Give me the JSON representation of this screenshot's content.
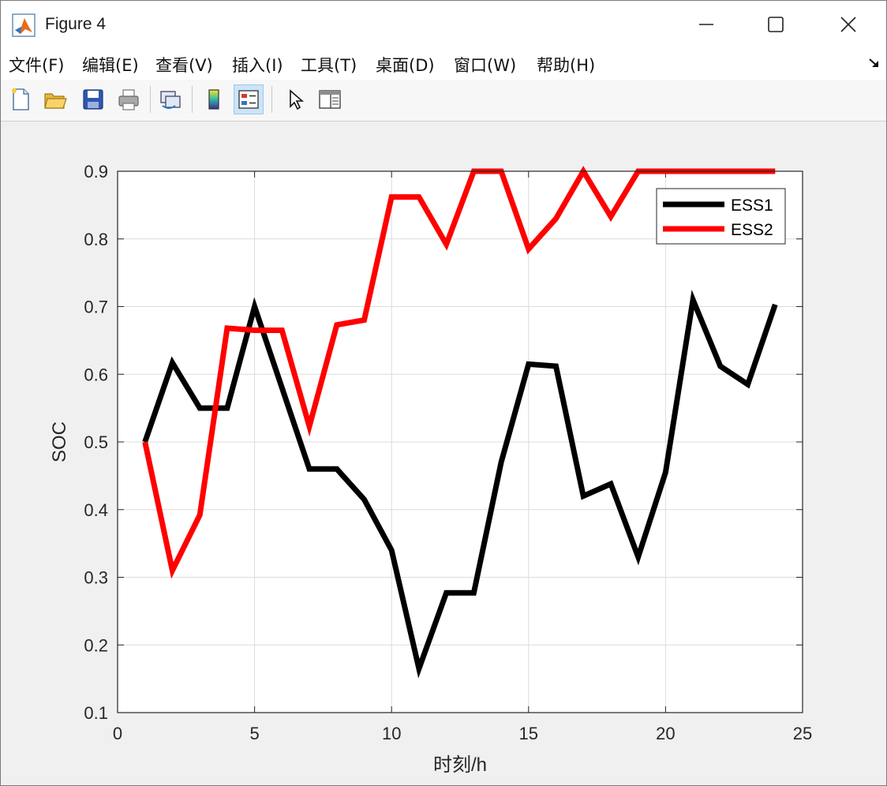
{
  "window": {
    "title": "Figure 4"
  },
  "menu": {
    "items": [
      {
        "label": "文件(F)",
        "key": "file"
      },
      {
        "label": "编辑(E)",
        "key": "edit"
      },
      {
        "label": "查看(V)",
        "key": "view"
      },
      {
        "label": "插入(I)",
        "key": "insert"
      },
      {
        "label": "工具(T)",
        "key": "tools"
      },
      {
        "label": "桌面(D)",
        "key": "desktop"
      },
      {
        "label": "窗口(W)",
        "key": "window"
      },
      {
        "label": "帮助(H)",
        "key": "help"
      }
    ]
  },
  "toolbar": {
    "buttons": [
      {
        "name": "new-figure-button",
        "icon": "new-file-icon"
      },
      {
        "name": "open-file-button",
        "icon": "folder-open-icon"
      },
      {
        "name": "save-button",
        "icon": "floppy-disk-icon"
      },
      {
        "name": "print-button",
        "icon": "printer-icon"
      },
      {
        "name": "link-plot-button",
        "icon": "link-plot-icon"
      },
      {
        "name": "insert-colorbar-button",
        "icon": "colorbar-icon"
      },
      {
        "name": "insert-legend-button",
        "icon": "legend-icon",
        "active": true
      },
      {
        "name": "edit-plot-button",
        "icon": "arrow-pointer-icon"
      },
      {
        "name": "property-inspector-button",
        "icon": "panel-icon"
      }
    ]
  },
  "chart_data": {
    "type": "line",
    "title": "",
    "xlabel": "时刻/h",
    "ylabel": "SOC",
    "xlim": [
      0,
      25
    ],
    "ylim": [
      0.1,
      0.9
    ],
    "xticks": [
      0,
      5,
      10,
      15,
      20,
      25
    ],
    "yticks": [
      0.1,
      0.2,
      0.3,
      0.4,
      0.5,
      0.6,
      0.7,
      0.8,
      0.9
    ],
    "grid": true,
    "legend_position": "top-right",
    "x": [
      1,
      2,
      3,
      4,
      5,
      6,
      7,
      8,
      9,
      10,
      11,
      12,
      13,
      14,
      15,
      16,
      17,
      18,
      19,
      20,
      21,
      22,
      23,
      24
    ],
    "series": [
      {
        "name": "ESS1",
        "color": "#000000",
        "values": [
          0.5,
          0.617,
          0.55,
          0.55,
          0.7,
          0.58,
          0.46,
          0.46,
          0.415,
          0.34,
          0.165,
          0.277,
          0.277,
          0.47,
          0.615,
          0.612,
          0.42,
          0.438,
          0.33,
          0.455,
          0.71,
          0.612,
          0.585,
          0.703
        ]
      },
      {
        "name": "ESS2",
        "color": "#ff0000",
        "values": [
          0.5,
          0.31,
          0.392,
          0.668,
          0.665,
          0.665,
          0.523,
          0.673,
          0.68,
          0.862,
          0.862,
          0.792,
          0.9,
          0.9,
          0.785,
          0.83,
          0.9,
          0.833,
          0.9,
          0.9,
          0.9,
          0.9,
          0.9,
          0.9
        ]
      }
    ]
  }
}
